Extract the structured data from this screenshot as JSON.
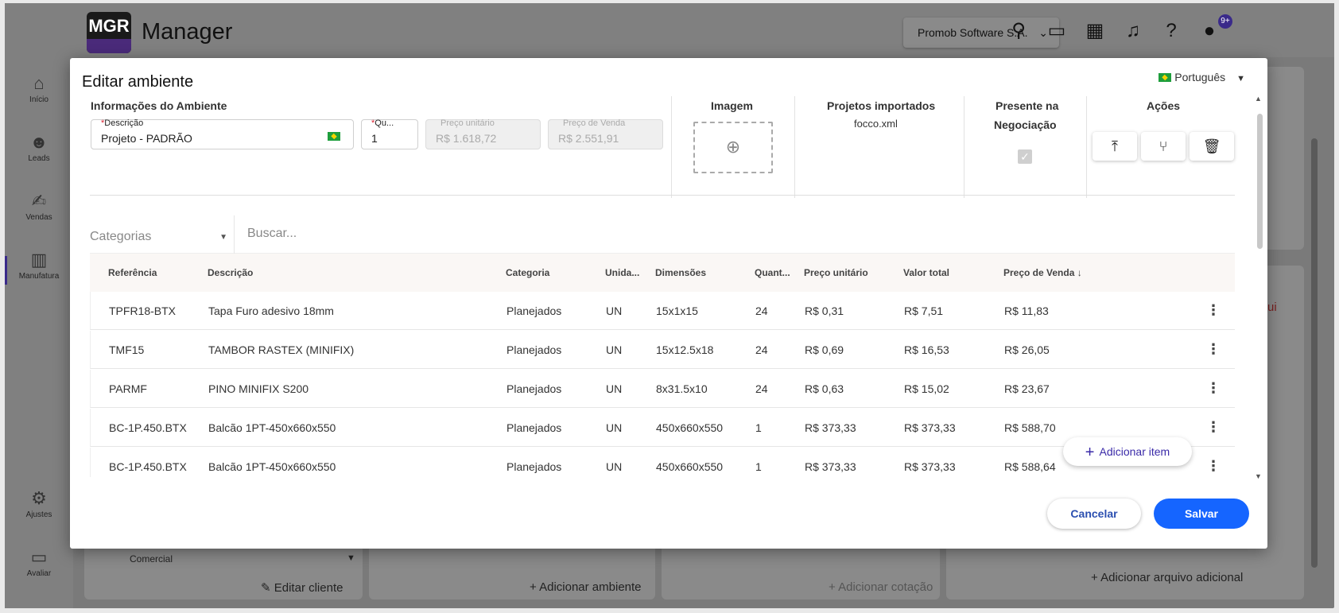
{
  "app": {
    "logo_text": "MGR",
    "title": "Manager",
    "company": "Promob Software S.A.",
    "notifications_badge": "9+"
  },
  "sidebar": {
    "items": [
      {
        "label": "Início",
        "icon": "home-icon"
      },
      {
        "label": "Leads",
        "icon": "people-icon"
      },
      {
        "label": "Vendas",
        "icon": "handshake-icon"
      },
      {
        "label": "Manufatura",
        "icon": "factory-icon"
      },
      {
        "label": "Ajustes",
        "icon": "gear-icon"
      },
      {
        "label": "Avaliar",
        "icon": "chat-icon"
      }
    ]
  },
  "background": {
    "comercial_label": "Comercial",
    "edit_client": "Editar cliente",
    "add_environment": "Adicionar ambiente",
    "add_quote": "Adicionar cotação",
    "add_file": "Adicionar arquivo adicional",
    "partial_text": "ui"
  },
  "modal": {
    "title": "Editar ambiente",
    "language": "Português",
    "info_section": "Informações do Ambiente",
    "fields": {
      "descricao_label": "Descrição",
      "descricao_value": "Projeto - PADRÃO",
      "qtd_label": "Qu...",
      "qtd_value": "1",
      "preco_unit_label": "Preço unitário",
      "preco_unit_value": "R$ 1.618,72",
      "preco_venda_label": "Preço de Venda",
      "preco_venda_value": "R$ 2.551,91"
    },
    "image_section": "Imagem",
    "imported_section": "Projetos importados",
    "imported_file": "focco.xml",
    "negotiation_line1": "Presente na",
    "negotiation_line2": "Negociação",
    "actions_section": "Ações",
    "categories_placeholder": "Categorias",
    "search_placeholder": "Buscar...",
    "columns": [
      "Referência",
      "Descrição",
      "Categoria",
      "Unida...",
      "Dimensões",
      "Quant...",
      "Preço unitário",
      "Valor total",
      "Preço de Venda"
    ],
    "rows": [
      [
        "TPFR18-BTX",
        "Tapa Furo adesivo 18mm",
        "Planejados",
        "UN",
        "15x1x15",
        "24",
        "R$ 0,31",
        "R$ 7,51",
        "R$ 11,83"
      ],
      [
        "TMF15",
        "TAMBOR RASTEX (MINIFIX)",
        "Planejados",
        "UN",
        "15x12.5x18",
        "24",
        "R$ 0,69",
        "R$ 16,53",
        "R$ 26,05"
      ],
      [
        "PARMF",
        "PINO MINIFIX S200",
        "Planejados",
        "UN",
        "8x31.5x10",
        "24",
        "R$ 0,63",
        "R$ 15,02",
        "R$ 23,67"
      ],
      [
        "BC-1P.450.BTX",
        "Balcão 1PT-450x660x550",
        "Planejados",
        "UN",
        "450x660x550",
        "1",
        "R$ 373,33",
        "R$ 373,33",
        "R$ 588,70"
      ],
      [
        "BC-1P.450.BTX",
        "Balcão 1PT-450x660x550",
        "Planejados",
        "UN",
        "450x660x550",
        "1",
        "R$ 373,33",
        "R$ 373,33",
        "R$ 588,64"
      ]
    ],
    "add_item": "Adicionar item",
    "cancel": "Cancelar",
    "save": "Salvar"
  }
}
